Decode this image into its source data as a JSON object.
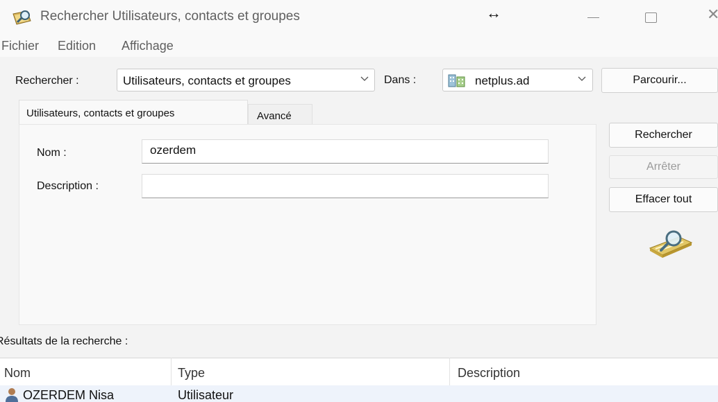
{
  "window": {
    "title": "Rechercher Utilisateurs, contacts et groupes",
    "resize_glyph": "↔",
    "close_glyph": "✕"
  },
  "menu": {
    "items": [
      "Fichier",
      "Edition",
      "Affichage"
    ]
  },
  "search": {
    "find_label": "Rechercher :",
    "find_value": "Utilisateurs, contacts et groupes",
    "in_label": "Dans :",
    "in_value": "netplus.ad",
    "browse_label": "Parcourir..."
  },
  "tabs": [
    {
      "label": "Utilisateurs, contacts et groupes",
      "active": true
    },
    {
      "label": "Avancé",
      "active": false
    }
  ],
  "form": {
    "name_label": "Nom :",
    "name_value": "ozerdem",
    "description_label": "Description :",
    "description_value": ""
  },
  "actions": {
    "search_label": "Rechercher",
    "stop_label": "Arrêter",
    "clear_label": "Effacer tout"
  },
  "results": {
    "label": "Résultats de la recherche :",
    "columns": [
      "Nom",
      "Type",
      "Description"
    ],
    "rows": [
      {
        "name": "OZERDEM Nisa",
        "type": "Utilisateur",
        "description": ""
      }
    ]
  },
  "icons": {
    "app": "search-directory-icon",
    "domain": "domain-icon",
    "user": "user-icon",
    "search_graphic": "magnifier-folder-icon"
  },
  "colors": {
    "row_selected": "#eef3fb",
    "window_bg": "#f3f3f3"
  }
}
